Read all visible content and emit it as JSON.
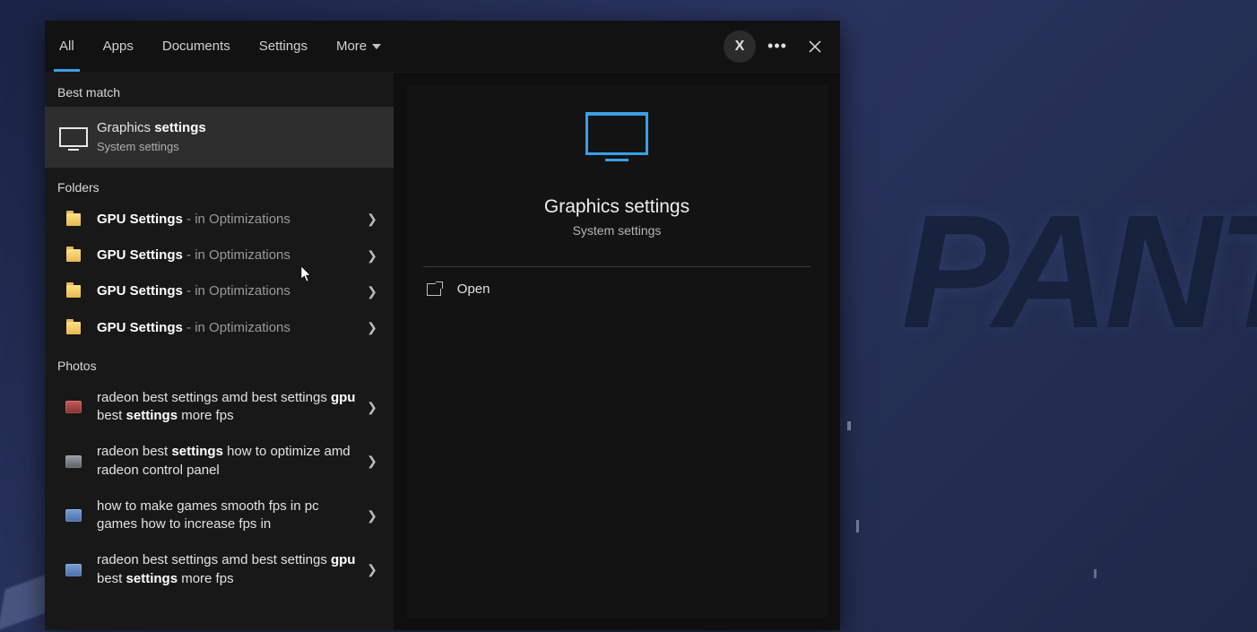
{
  "bg_text": "PANT",
  "tabs": {
    "all": "All",
    "apps": "Apps",
    "documents": "Documents",
    "settings": "Settings",
    "more": "More"
  },
  "top_actions": {
    "x_badge": "X"
  },
  "sections": {
    "best_match": "Best match",
    "folders": "Folders",
    "photos": "Photos"
  },
  "best_match": {
    "title_pre": "Graphics ",
    "title_bold": "settings",
    "subtitle": "System settings"
  },
  "folders": [
    {
      "name": "GPU Settings",
      "location": " - in Optimizations"
    },
    {
      "name": "GPU Settings",
      "location": " - in Optimizations"
    },
    {
      "name": "GPU Settings",
      "location": " - in Optimizations"
    },
    {
      "name": "GPU Settings",
      "location": " - in Optimizations"
    }
  ],
  "photos": [
    {
      "seg1": "radeon best settings amd best settings ",
      "b1": "gpu",
      "seg2": " best ",
      "b2": "settings",
      "seg3": " more fps",
      "iconClass": "red"
    },
    {
      "seg1": "radeon best ",
      "b1": "settings",
      "seg2": " how to optimize amd radeon control panel",
      "b2": "",
      "seg3": "",
      "iconClass": "gray"
    },
    {
      "seg1": "how to make games smooth fps in pc games how to increase fps in",
      "b1": "",
      "seg2": "",
      "b2": "",
      "seg3": "",
      "iconClass": ""
    },
    {
      "seg1": "radeon best settings amd best settings ",
      "b1": "gpu",
      "seg2": " best ",
      "b2": "settings",
      "seg3": " more fps",
      "iconClass": ""
    }
  ],
  "preview": {
    "title": "Graphics settings",
    "subtitle": "System settings",
    "open": "Open"
  }
}
